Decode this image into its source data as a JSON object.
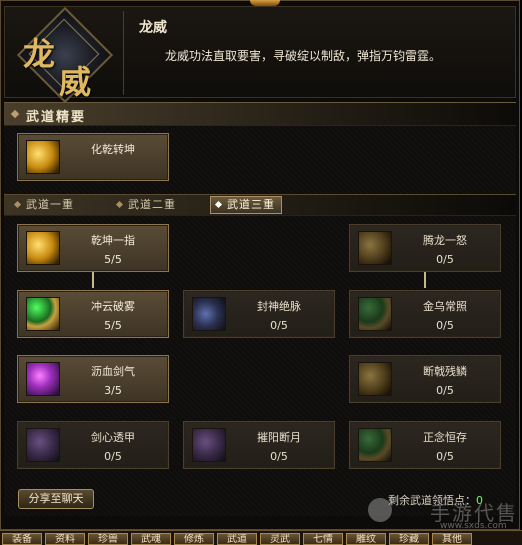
{
  "header": {
    "emblem_chars": [
      "龙",
      "威"
    ],
    "title": "龙威",
    "description": "龙威功法直取要害，寻破绽以制敌，弹指万钧雷霆。"
  },
  "essentials": {
    "section_title": "武道精要",
    "card": {
      "name": "化乾转坤",
      "icon": "gold-fist-icon"
    }
  },
  "tabs": [
    {
      "label": "武道一重",
      "active": false
    },
    {
      "label": "武道二重",
      "active": false
    },
    {
      "label": "武道三重",
      "active": true
    }
  ],
  "skills": [
    {
      "name": "乾坤一指",
      "value": "5/5",
      "icon": "gold-finger-icon",
      "active": true
    },
    {
      "name": "腾龙一怒",
      "value": "0/5",
      "icon": "gold-dragon-icon",
      "active": false
    },
    {
      "name": "冲云破雾",
      "value": "5/5",
      "icon": "green-swirl-fist-icon",
      "active": true
    },
    {
      "name": "封神绝脉",
      "value": "0/5",
      "icon": "blue-strike-icon",
      "active": false
    },
    {
      "name": "金乌常照",
      "value": "0/5",
      "icon": "green-sun-icon",
      "active": false
    },
    {
      "name": "沥血剑气",
      "value": "3/5",
      "icon": "purple-sword-qi-icon",
      "active": true
    },
    {
      "name": "断戟残鳞",
      "value": "0/5",
      "icon": "gold-halberd-icon",
      "active": false
    },
    {
      "name": "剑心透甲",
      "value": "0/5",
      "icon": "purple-blade-icon",
      "active": false
    },
    {
      "name": "摧阳断月",
      "value": "0/5",
      "icon": "purple-moon-icon",
      "active": false
    },
    {
      "name": "正念恒存",
      "value": "0/5",
      "icon": "green-mind-icon",
      "active": false
    }
  ],
  "footer": {
    "share_label": "分享至聊天",
    "points_label": "剩余武道领悟点：",
    "points_value": "0"
  },
  "watermark": {
    "text": "手游代售",
    "url": "www.sxds.com"
  },
  "menu": [
    "装备",
    "资料",
    "珍兽",
    "武魂",
    "修炼",
    "武道",
    "灵武",
    "七情",
    "雕纹",
    "珍藏",
    "其他"
  ]
}
